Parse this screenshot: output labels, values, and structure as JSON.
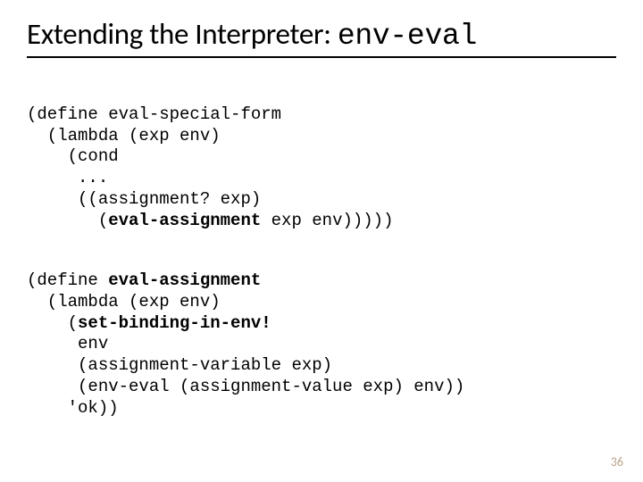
{
  "title_plain": "Extending the Interpreter: ",
  "title_mono": "env-eval",
  "code": {
    "l1": "(define eval-special-form",
    "l2": "  (lambda (exp env)",
    "l3": "    (cond",
    "l4": "     ...",
    "l5": "     ((assignment? exp)",
    "l6a": "       (",
    "l6b": "eval-assignment",
    "l6c": " exp env)))))",
    "l7": "(define ",
    "l7b": "eval-assignment",
    "l8": "  (lambda (exp env)",
    "l9a": "    (",
    "l9b": "set-binding-in-env!",
    "l10": "     env",
    "l11": "     (assignment-variable exp)",
    "l12": "     (env-eval (assignment-value exp) env))",
    "l13": "    'ok))"
  },
  "page_number": "36"
}
